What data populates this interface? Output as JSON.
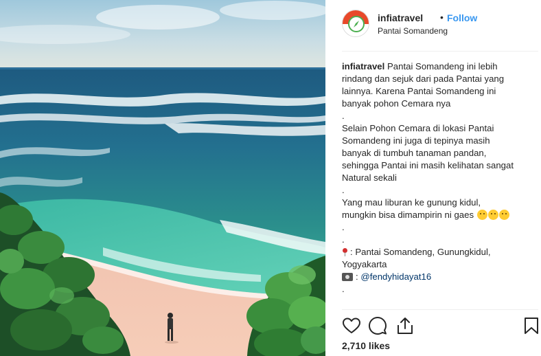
{
  "post": {
    "username": "infiatravel",
    "separator": "•",
    "follow_label": "Follow",
    "location": "Pantai Somandeng",
    "likes": "2,710 likes"
  },
  "caption": {
    "username": "infiatravel",
    "line1": " Pantai Somandeng ini lebih",
    "line2": "rindang dan sejuk dari pada Pantai yang",
    "line3": "lainnya. Karena Pantai Somandeng ini",
    "line4": "banyak pohon Cemara nya",
    "dot1": ".",
    "line5": "Selain Pohon Cemara di lokasi Pantai",
    "line6": "Somandeng ini juga di tepinya masih",
    "line7": "banyak di tumbuh tanaman pandan,",
    "line8": "sehingga Pantai ini masih kelihatan sangat",
    "line9": "Natural sekali",
    "dot2": ".",
    "line10": "Yang mau liburan ke gunung kidul,",
    "line11": "mungkin bisa dimampirin ni gaes",
    "dot3": ".",
    "dot4": ".",
    "location_line1": ": Pantai Somandeng, Gunungkidul,",
    "location_line2": "Yogyakarta",
    "credit_prefix": ": ",
    "credit_mention": "@fendyhidayat16",
    "dot5": "."
  },
  "icons": {
    "avatar": "compass-logo-icon",
    "like": "heart-icon",
    "comment": "comment-icon",
    "share": "share-icon",
    "save": "bookmark-icon",
    "pin": "round-pushpin-icon",
    "camera": "camera-icon"
  },
  "colors": {
    "follow": "#3897f0",
    "mention": "#003569",
    "text": "#262626",
    "avatar_brand": "#e8492a",
    "avatar_accent": "#4caf50"
  }
}
